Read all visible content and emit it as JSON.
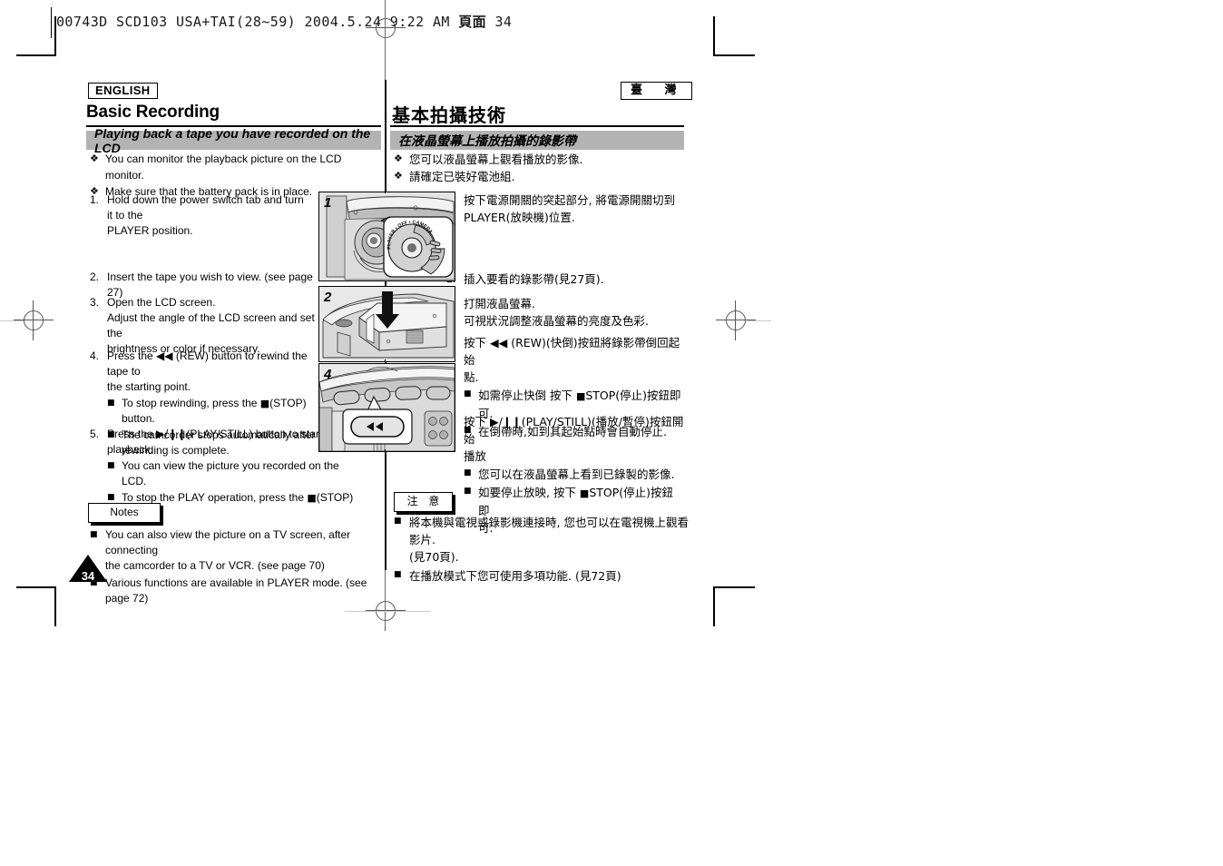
{
  "slug": {
    "text": "00743D SCD103 USA+TAI(28~59)  2004.5.24  9:22 AM  ",
    "cjk": "頁面",
    "page": " 34"
  },
  "page_number": "34",
  "left_column": {
    "language_tag": "ENGLISH",
    "chapter_title": "Basic Recording",
    "section_title": "Playing back a tape you have recorded on the LCD",
    "bullets": [
      "You can monitor the playback picture on the LCD monitor.",
      "Make sure that the battery pack is in place."
    ],
    "steps": [
      {
        "num": "1.",
        "line1": "Hold down the power switch tab and turn it to the",
        "line2": "PLAYER position.",
        "subs": []
      },
      {
        "num": "2.",
        "line1": "Insert the tape you wish to view. (see page 27)",
        "line2": "",
        "subs": []
      },
      {
        "num": "3.",
        "line1": "Open the LCD screen.",
        "line2": "Adjust the angle of the LCD screen and set the",
        "line3": "brightness or color if necessary.",
        "subs": []
      },
      {
        "num": "4.",
        "line1_pre": "Press the ",
        "line1_glyph": "◀◀",
        "line1_post": " (REW) button to rewind the tape to",
        "line2": "the starting point.",
        "subs": [
          {
            "pre": "To stop rewinding, press the ",
            "glyph": "■",
            "post": "(STOP) button."
          },
          {
            "pre": "The camcorder stops automatically after",
            "glyph": "",
            "post": ""
          },
          {
            "pre": "rewinding is complete.",
            "glyph": "",
            "post": ""
          }
        ]
      },
      {
        "num": "5.",
        "line1_pre": "Press the ",
        "line1_glyph": "▶/❙❙",
        "line1_post": "(PLAY/STILL) button to start",
        "line2": "playback.",
        "subs": [
          {
            "pre": "You can view the picture you recorded on the",
            "glyph": "",
            "post": ""
          },
          {
            "pre": "LCD.",
            "glyph": "",
            "post": ""
          },
          {
            "pre": "To stop the PLAY operation, press the ",
            "glyph": "■",
            "post": "(STOP) button."
          }
        ]
      }
    ],
    "notes_label": "Notes",
    "notes": [
      "You can also view the picture on a TV screen, after connecting",
      "the camcorder to a TV or VCR. (see page 70)",
      "Various functions are available in PLAYER mode. (see page 72)"
    ]
  },
  "right_column": {
    "language_tag": "臺 灣",
    "chapter_title": "基本拍攝技術",
    "section_title": "在液晶螢幕上播放拍攝的錄影帶",
    "bullets": [
      "您可以液晶螢幕上觀看播放的影像.",
      "請確定已裝好電池組."
    ],
    "steps": [
      {
        "num": "1.",
        "line1": "按下電源開關的突起部分, 將電源開關切到",
        "line2": "PLAYER(放映機)位置.",
        "subs": []
      },
      {
        "num": "2.",
        "line1": "插入要看的錄影帶(見27頁).",
        "line2": "",
        "subs": []
      },
      {
        "num": "3.",
        "line1": "打開液晶螢幕.",
        "line2": "可視狀況調整液晶螢幕的亮度及色彩.",
        "subs": []
      },
      {
        "num": "4.",
        "line1_pre": "按下 ",
        "line1_glyph": "◀◀",
        "line1_post": " (REW)(快倒)按鈕將錄影帶倒回起始",
        "line2": "點.",
        "subs": [
          {
            "pre": "如需停止快倒 按下 ",
            "glyph": "■",
            "post": "STOP(停止)按鈕即"
          },
          {
            "pre": "可.",
            "glyph": "",
            "post": ""
          },
          {
            "pre": "在倒帶時,如到其起始點時會自動停止.",
            "glyph": "",
            "post": ""
          }
        ]
      },
      {
        "num": "5.",
        "line1_pre": "按下 ",
        "line1_glyph": "▶/❙❙",
        "line1_post": "(PLAY/STILL)(播放/暫停)按鈕開始",
        "line2": "播放",
        "subs": [
          {
            "pre": "您可以在液晶螢幕上看到已錄製的影像.",
            "glyph": "",
            "post": ""
          },
          {
            "pre": "如要停止放映, 按下 ",
            "glyph": "■",
            "post": "STOP(停止)按鈕即"
          },
          {
            "pre": "可.",
            "glyph": "",
            "post": ""
          }
        ]
      }
    ],
    "notes_label": "注 意",
    "notes": [
      "將本機與電視或錄影機連接時, 您也可以在電視機上觀看影片.",
      "(見70頁).",
      "在播放模式下您可使用多項功能. (見72頁)"
    ]
  },
  "figures": [
    {
      "badge": "1",
      "caption_semantic": "power-switch-dial",
      "dial_labels": [
        "PLAYER",
        "OFF",
        "CAMERA"
      ]
    },
    {
      "badge": "2",
      "caption_semantic": "tape-cassette-insert"
    },
    {
      "badge": "4",
      "caption_semantic": "rew-button-callout",
      "button_glyph": "◀◀"
    }
  ],
  "colors": {
    "section_bar": "#b3b3b3",
    "figure_bg": "#e9e9e9",
    "rule": "#000000"
  }
}
